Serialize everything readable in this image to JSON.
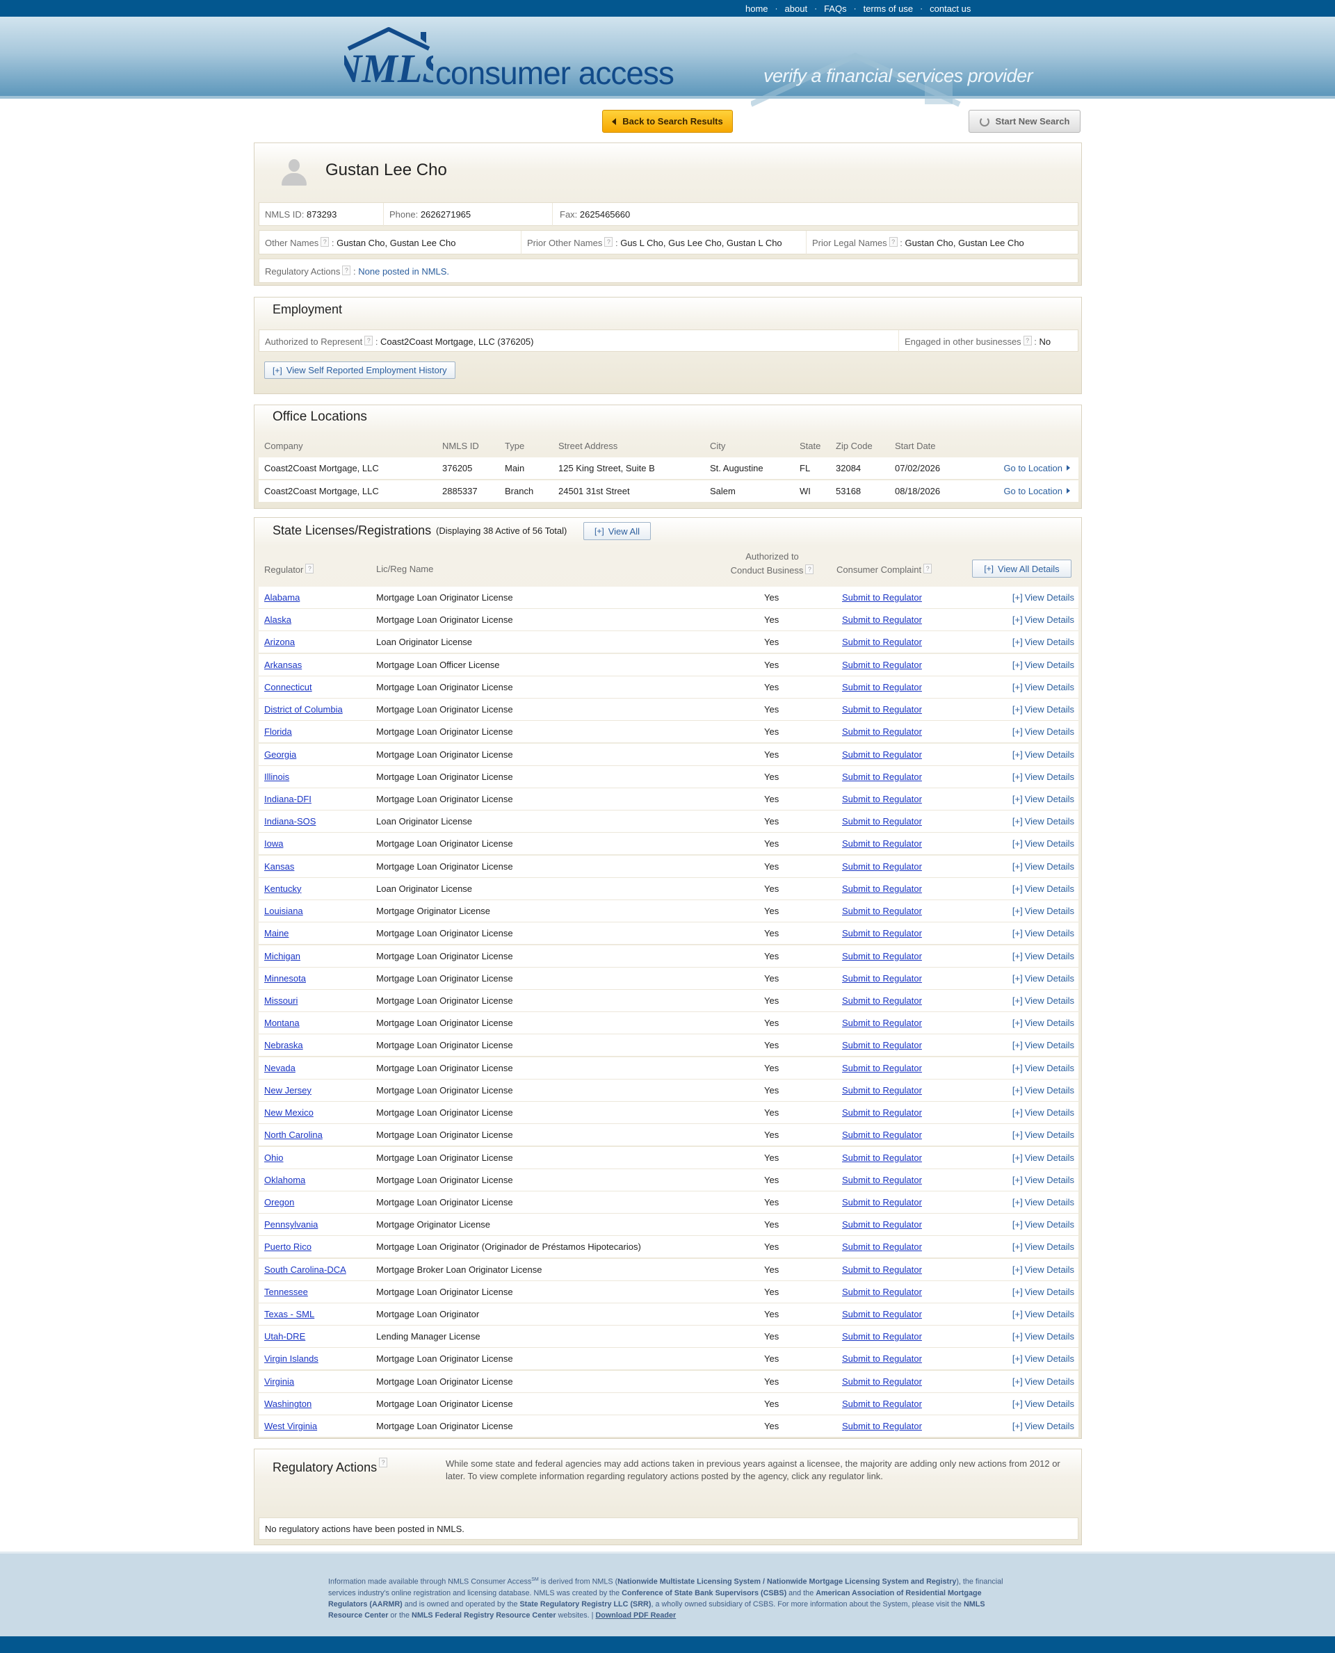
{
  "nav": {
    "links": [
      "home",
      "about",
      "FAQs",
      "terms of use",
      "contact us"
    ]
  },
  "banner": {
    "logo_text": "NMLS",
    "title": "consumer access",
    "tagline": "verify a financial services provider"
  },
  "buttons": {
    "back": "Back to Search Results",
    "new_search": "Start New Search"
  },
  "person": {
    "name": "Gustan Lee Cho",
    "nmls_id_label": "NMLS ID:",
    "nmls_id": "873293",
    "phone_label": "Phone:",
    "phone": "2626271965",
    "fax_label": "Fax:",
    "fax": "2625465660",
    "other_names_label": "Other Names",
    "other_names": "Gustan Cho, Gustan Lee Cho",
    "prior_other_names_label": "Prior Other Names",
    "prior_other_names": "Gus L Cho, Gus Lee Cho, Gustan L Cho",
    "prior_legal_names_label": "Prior Legal Names",
    "prior_legal_names": "Gustan Cho, Gustan Lee Cho",
    "regulatory_actions_label": "Regulatory Actions",
    "regulatory_actions": "None posted in NMLS."
  },
  "employment": {
    "title": "Employment",
    "authorized_label": "Authorized to Represent",
    "authorized_value": "Coast2Coast Mortgage, LLC (376205)",
    "engaged_label": "Engaged in other businesses",
    "engaged_value": "No",
    "history_button": "View Self Reported Employment History"
  },
  "offices": {
    "title": "Office Locations",
    "headers": [
      "Company",
      "NMLS ID",
      "Type",
      "Street Address",
      "City",
      "State",
      "Zip Code",
      "Start Date"
    ],
    "goto_label": "Go to Location",
    "rows": [
      [
        "Coast2Coast Mortgage, LLC",
        "376205",
        "Main",
        "125 King Street, Suite B",
        "St. Augustine",
        "FL",
        "32084",
        "07/02/2026"
      ],
      [
        "Coast2Coast Mortgage, LLC",
        "2885337",
        "Branch",
        "24501 31st Street",
        "Salem",
        "WI",
        "53168",
        "08/18/2026"
      ]
    ]
  },
  "licenses": {
    "title": "State Licenses/Registrations",
    "display_note": "(Displaying 38 Active of 56 Total)",
    "view_all": "View All",
    "view_all_details": "View All Details",
    "col_regulator": "Regulator",
    "col_name": "Lic/Reg Name",
    "col_auth_1": "Authorized to",
    "col_auth_2": "Conduct Business",
    "col_complaint": "Consumer Complaint",
    "submit_label": "Submit to Regulator",
    "view_details_label": "View Details",
    "plus_label": "[+]",
    "rows": [
      [
        "Alabama",
        "Mortgage Loan Originator License",
        "Yes"
      ],
      [
        "Alaska",
        "Mortgage Loan Originator License",
        "Yes"
      ],
      [
        "Arizona",
        "Loan Originator License",
        "Yes"
      ],
      [
        "Arkansas",
        "Mortgage Loan Officer License",
        "Yes"
      ],
      [
        "Connecticut",
        "Mortgage Loan Originator License",
        "Yes"
      ],
      [
        "District of Columbia",
        "Mortgage Loan Originator License",
        "Yes"
      ],
      [
        "Florida",
        "Mortgage Loan Originator License",
        "Yes"
      ],
      [
        "Georgia",
        "Mortgage Loan Originator License",
        "Yes"
      ],
      [
        "Illinois",
        "Mortgage Loan Originator License",
        "Yes"
      ],
      [
        "Indiana-DFI",
        "Mortgage Loan Originator License",
        "Yes"
      ],
      [
        "Indiana-SOS",
        "Loan Originator License",
        "Yes"
      ],
      [
        "Iowa",
        "Mortgage Loan Originator License",
        "Yes"
      ],
      [
        "Kansas",
        "Mortgage Loan Originator License",
        "Yes"
      ],
      [
        "Kentucky",
        "Loan Originator License",
        "Yes"
      ],
      [
        "Louisiana",
        "Mortgage Originator License",
        "Yes"
      ],
      [
        "Maine",
        "Mortgage Loan Originator License",
        "Yes"
      ],
      [
        "Michigan",
        "Mortgage Loan Originator License",
        "Yes"
      ],
      [
        "Minnesota",
        "Mortgage Loan Originator License",
        "Yes"
      ],
      [
        "Missouri",
        "Mortgage Loan Originator License",
        "Yes"
      ],
      [
        "Montana",
        "Mortgage Loan Originator License",
        "Yes"
      ],
      [
        "Nebraska",
        "Mortgage Loan Originator License",
        "Yes"
      ],
      [
        "Nevada",
        "Mortgage Loan Originator License",
        "Yes"
      ],
      [
        "New Jersey",
        "Mortgage Loan Originator License",
        "Yes"
      ],
      [
        "New Mexico",
        "Mortgage Loan Originator License",
        "Yes"
      ],
      [
        "North Carolina",
        "Mortgage Loan Originator License",
        "Yes"
      ],
      [
        "Ohio",
        "Mortgage Loan Originator License",
        "Yes"
      ],
      [
        "Oklahoma",
        "Mortgage Loan Originator License",
        "Yes"
      ],
      [
        "Oregon",
        "Mortgage Loan Originator License",
        "Yes"
      ],
      [
        "Pennsylvania",
        "Mortgage Originator License",
        "Yes"
      ],
      [
        "Puerto Rico",
        "Mortgage Loan Originator (Originador de Préstamos Hipotecarios)",
        "Yes"
      ],
      [
        "South Carolina-DCA",
        "Mortgage Broker Loan Originator License",
        "Yes"
      ],
      [
        "Tennessee",
        "Mortgage Loan Originator License",
        "Yes"
      ],
      [
        "Texas - SML",
        "Mortgage Loan Originator",
        "Yes"
      ],
      [
        "Utah-DRE",
        "Lending Manager License",
        "Yes"
      ],
      [
        "Virgin Islands",
        "Mortgage Loan Originator License",
        "Yes"
      ],
      [
        "Virginia",
        "Mortgage Loan Originator License",
        "Yes"
      ],
      [
        "Washington",
        "Mortgage Loan Originator License",
        "Yes"
      ],
      [
        "West Virginia",
        "Mortgage Loan Originator License",
        "Yes"
      ]
    ]
  },
  "reg_actions": {
    "title": "Regulatory Actions",
    "note": "While some state and federal agencies may add actions taken in previous years against a licensee, the majority are adding only new actions from 2012 or later. To view complete information regarding regulatory actions posted by the agency, click any regulator link.",
    "empty": "No regulatory actions have been posted in NMLS."
  },
  "footer": {
    "p1": "Information made available through NMLS Consumer Access",
    "sm": "SM",
    "p2": " is derived from NMLS (",
    "b1": "Nationwide Multistate Licensing System / Nationwide Mortgage Licensing System and Registry",
    "p3": "), the financial services industry's online registration and licensing database. NMLS was created by the ",
    "b2": "Conference of State Bank Supervisors (CSBS)",
    "p4": " and the ",
    "b3": "American Association of Residential Mortgage Regulators (AARMR)",
    "p5": " and is owned and operated by the ",
    "b4": "State Regulatory Registry LLC (SRR)",
    "p6": ", a wholly owned subsidiary of CSBS. For more information about the System, please visit the ",
    "b5": "NMLS Resource Center",
    "p7": " or the ",
    "b6": "NMLS Federal Registry Resource Center",
    "p8": " websites. | ",
    "pdf": "Download PDF Reader"
  },
  "colors": {
    "nav_blue": "#03578f",
    "link_blue": "#2c5f9e",
    "regulator_link": "#1a35c4",
    "back_button": "#f6a700"
  },
  "icons": [
    "avatar-icon",
    "help-icon",
    "refresh-icon",
    "back-arrow-icon",
    "arrow-right-icon"
  ]
}
